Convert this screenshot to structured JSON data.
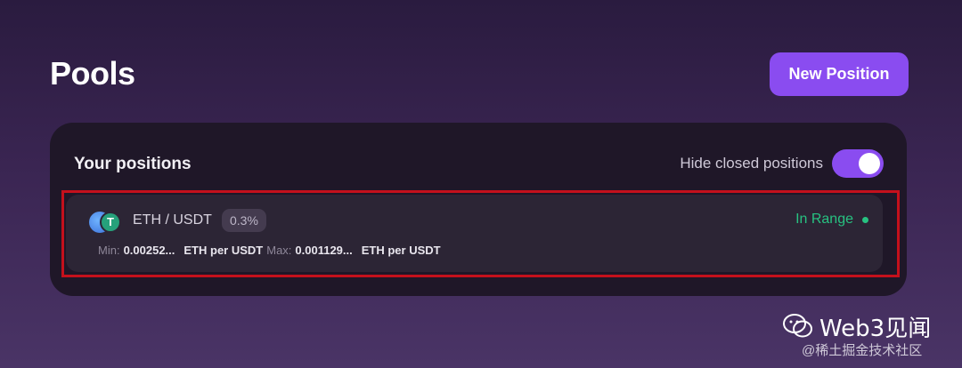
{
  "header": {
    "title": "Pools",
    "new_position_label": "New Position"
  },
  "positions_card": {
    "title": "Your positions",
    "hide_closed_label": "Hide closed positions",
    "hide_closed_enabled": true
  },
  "positions": [
    {
      "pair": "ETH / USDT",
      "fee": "0.3%",
      "status": "In Range",
      "min_label": "Min:",
      "min_value": "0.00252...",
      "min_unit": "ETH per USDT",
      "max_label": "Max:",
      "max_value": "0.001129...",
      "max_unit": "ETH per USDT",
      "tokens": [
        "eth-icon",
        "usdt-icon"
      ],
      "usdt_glyph": "T"
    }
  ],
  "watermark": {
    "title": "Web3见闻",
    "subtitle": "@稀土掘金技术社区"
  },
  "colors": {
    "accent": "#8a4cf0",
    "in_range": "#27c281",
    "highlight_border": "#c4101c"
  }
}
